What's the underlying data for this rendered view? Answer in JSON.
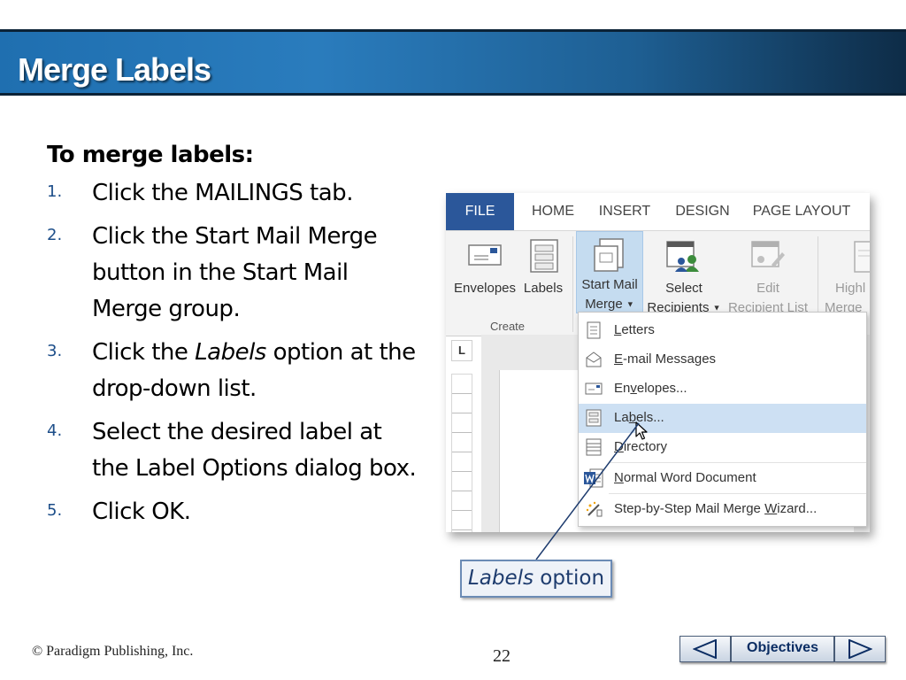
{
  "slide": {
    "title": "Merge Labels",
    "intro": "To merge labels:",
    "steps": [
      {
        "num": "1.",
        "text": "Click the MAILINGS tab."
      },
      {
        "num": "2.",
        "text": "Click the Start Mail Merge button in the Start Mail Merge group."
      },
      {
        "num": "3.",
        "pre": "Click the ",
        "em": "Labels",
        "post": " option at the drop-down list."
      },
      {
        "num": "4.",
        "text": "Select the desired label at the Label Options dialog box."
      },
      {
        "num": "5.",
        "text": "Click OK."
      }
    ],
    "callout": {
      "em": "Labels",
      "text": " option"
    }
  },
  "word": {
    "tabs": [
      "FILE",
      "HOME",
      "INSERT",
      "DESIGN",
      "PAGE LAYOUT"
    ],
    "ribbon": {
      "envelopes": "Envelopes",
      "labels": "Labels",
      "start_mail_merge": [
        "Start Mail",
        "Merge"
      ],
      "select_recipients": [
        "Select",
        "Recipients"
      ],
      "edit_recipient_list": [
        "Edit",
        "Recipient List"
      ],
      "highlight_merge": [
        "Highl",
        "Merge"
      ],
      "create_group": "Create",
      "ruler_corner": "L"
    },
    "menu": [
      {
        "u": "L",
        "rest": "etters",
        "icon": "letter-icon"
      },
      {
        "u": "E",
        "rest": "-mail Messages",
        "icon": "email-icon"
      },
      {
        "pre": "En",
        "u": "v",
        "rest": "elopes...",
        "icon": "envelope-icon"
      },
      {
        "pre": "La",
        "u": "b",
        "rest": "els...",
        "icon": "labels-icon"
      },
      {
        "u": "D",
        "rest": "irectory",
        "icon": "directory-icon"
      },
      {
        "u": "N",
        "rest": "ormal Word Document",
        "icon": "word-document-icon"
      },
      {
        "pre": "Step-by-Step Mail Merge ",
        "u": "W",
        "rest": "izard...",
        "icon": "wizard-icon"
      }
    ]
  },
  "footer": {
    "copyright": "© Paradigm Publishing, Inc.",
    "page": "22",
    "objectives": "Objectives"
  },
  "colors": {
    "accent": "#2b579a",
    "banner": "#1f6fb0",
    "step_number": "#1d4e89",
    "menu_highlight": "#cde0f3"
  }
}
